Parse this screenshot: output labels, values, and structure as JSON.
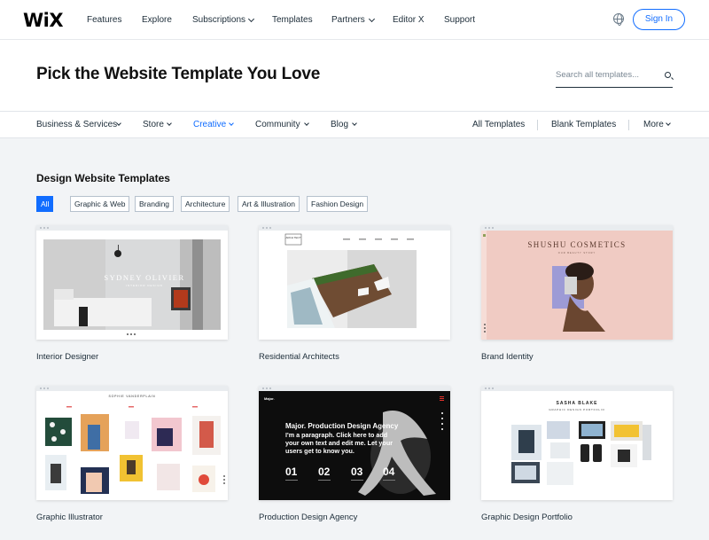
{
  "brand": {
    "logo": "WiX",
    "accent": "#116dff"
  },
  "topnav": {
    "items": [
      "Features",
      "Explore",
      "Subscriptions",
      "Templates",
      "Partners",
      "Editor X",
      "Support"
    ],
    "sign_in": "Sign In"
  },
  "hero": {
    "title": "Pick the Website Template You Love",
    "search_placeholder": "Search all templates..."
  },
  "categories": {
    "left": [
      "Business & Services",
      "Store",
      "Creative",
      "Community",
      "Blog"
    ],
    "active": "Creative",
    "right": [
      "All Templates",
      "Blank Templates",
      "More"
    ]
  },
  "main": {
    "section_title": "Design Website Templates",
    "chips": [
      "All",
      "Graphic & Web",
      "Branding",
      "Architecture",
      "Art & Illustration",
      "Fashion Design"
    ],
    "active_chip": "All"
  },
  "templates": [
    {
      "name": "Interior Designer",
      "preview_text": "SYDNEY OLIVIER"
    },
    {
      "name": "Residential Architects",
      "preview_text": "ARCH TECT"
    },
    {
      "name": "Brand Identity",
      "preview_text": "SHUSHU COSMETICS"
    },
    {
      "name": "Graphic Illustrator",
      "preview_text": "SOPHIE VANDERPLAIN"
    },
    {
      "name": "Production Design Agency",
      "preview_text": "Major. Production Design Agency",
      "preview_body": "I'm a paragraph. Click here to add your own text and edit me. Let your users get to know you.",
      "preview_numbers": [
        "01",
        "02",
        "03",
        "04"
      ],
      "preview_logo": "Major."
    },
    {
      "name": "Graphic Design Portfolio",
      "preview_text": "SASHA BLAKE",
      "preview_subtext": "GRAPHIC DESIGN PORTFOLIO"
    }
  ]
}
